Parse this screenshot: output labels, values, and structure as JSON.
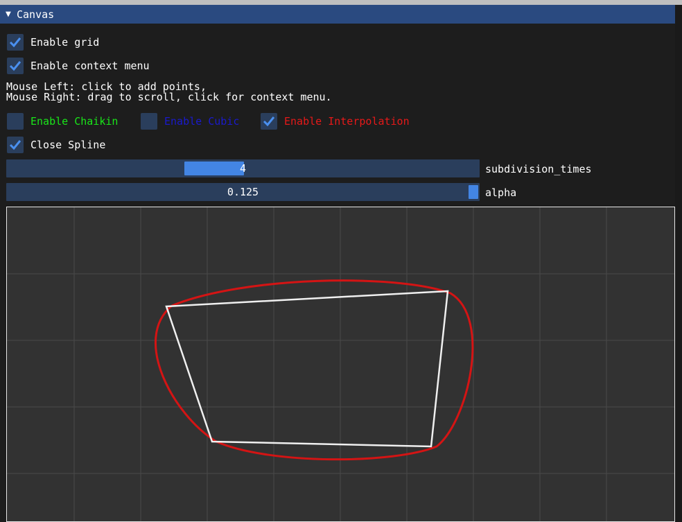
{
  "window": {
    "title": "Canvas",
    "collapse_icon": "triangle-down-icon"
  },
  "options": {
    "enable_grid": {
      "label": "Enable grid",
      "checked": true
    },
    "enable_context_menu": {
      "label": "Enable context menu",
      "checked": true
    },
    "help_line1": "Mouse Left: click to add points,",
    "help_line2": "Mouse Right: drag to scroll, click for context menu.",
    "enable_chaikin": {
      "label": "Enable Chaikin",
      "checked": false,
      "color": "#19e619"
    },
    "enable_cubic": {
      "label": "Enable Cubic",
      "checked": false,
      "color": "#1a1acc"
    },
    "enable_interpolation": {
      "label": "Enable Interpolation",
      "checked": true,
      "color": "#e61919"
    },
    "close_spline": {
      "label": "Close Spline",
      "checked": true
    }
  },
  "sliders": {
    "subdivision_times": {
      "label": "subdivision_times",
      "value": "4"
    },
    "alpha": {
      "label": "alpha",
      "value": "0.125"
    }
  },
  "colors": {
    "accent": "#4385e4",
    "frame_bg": "#2a3e5c",
    "title_bg": "#2a4a80",
    "canvas_bg": "#323232",
    "grid": "#c8c8c8",
    "polygon": "#ffffff",
    "interpolation_curve": "#d41414"
  }
}
